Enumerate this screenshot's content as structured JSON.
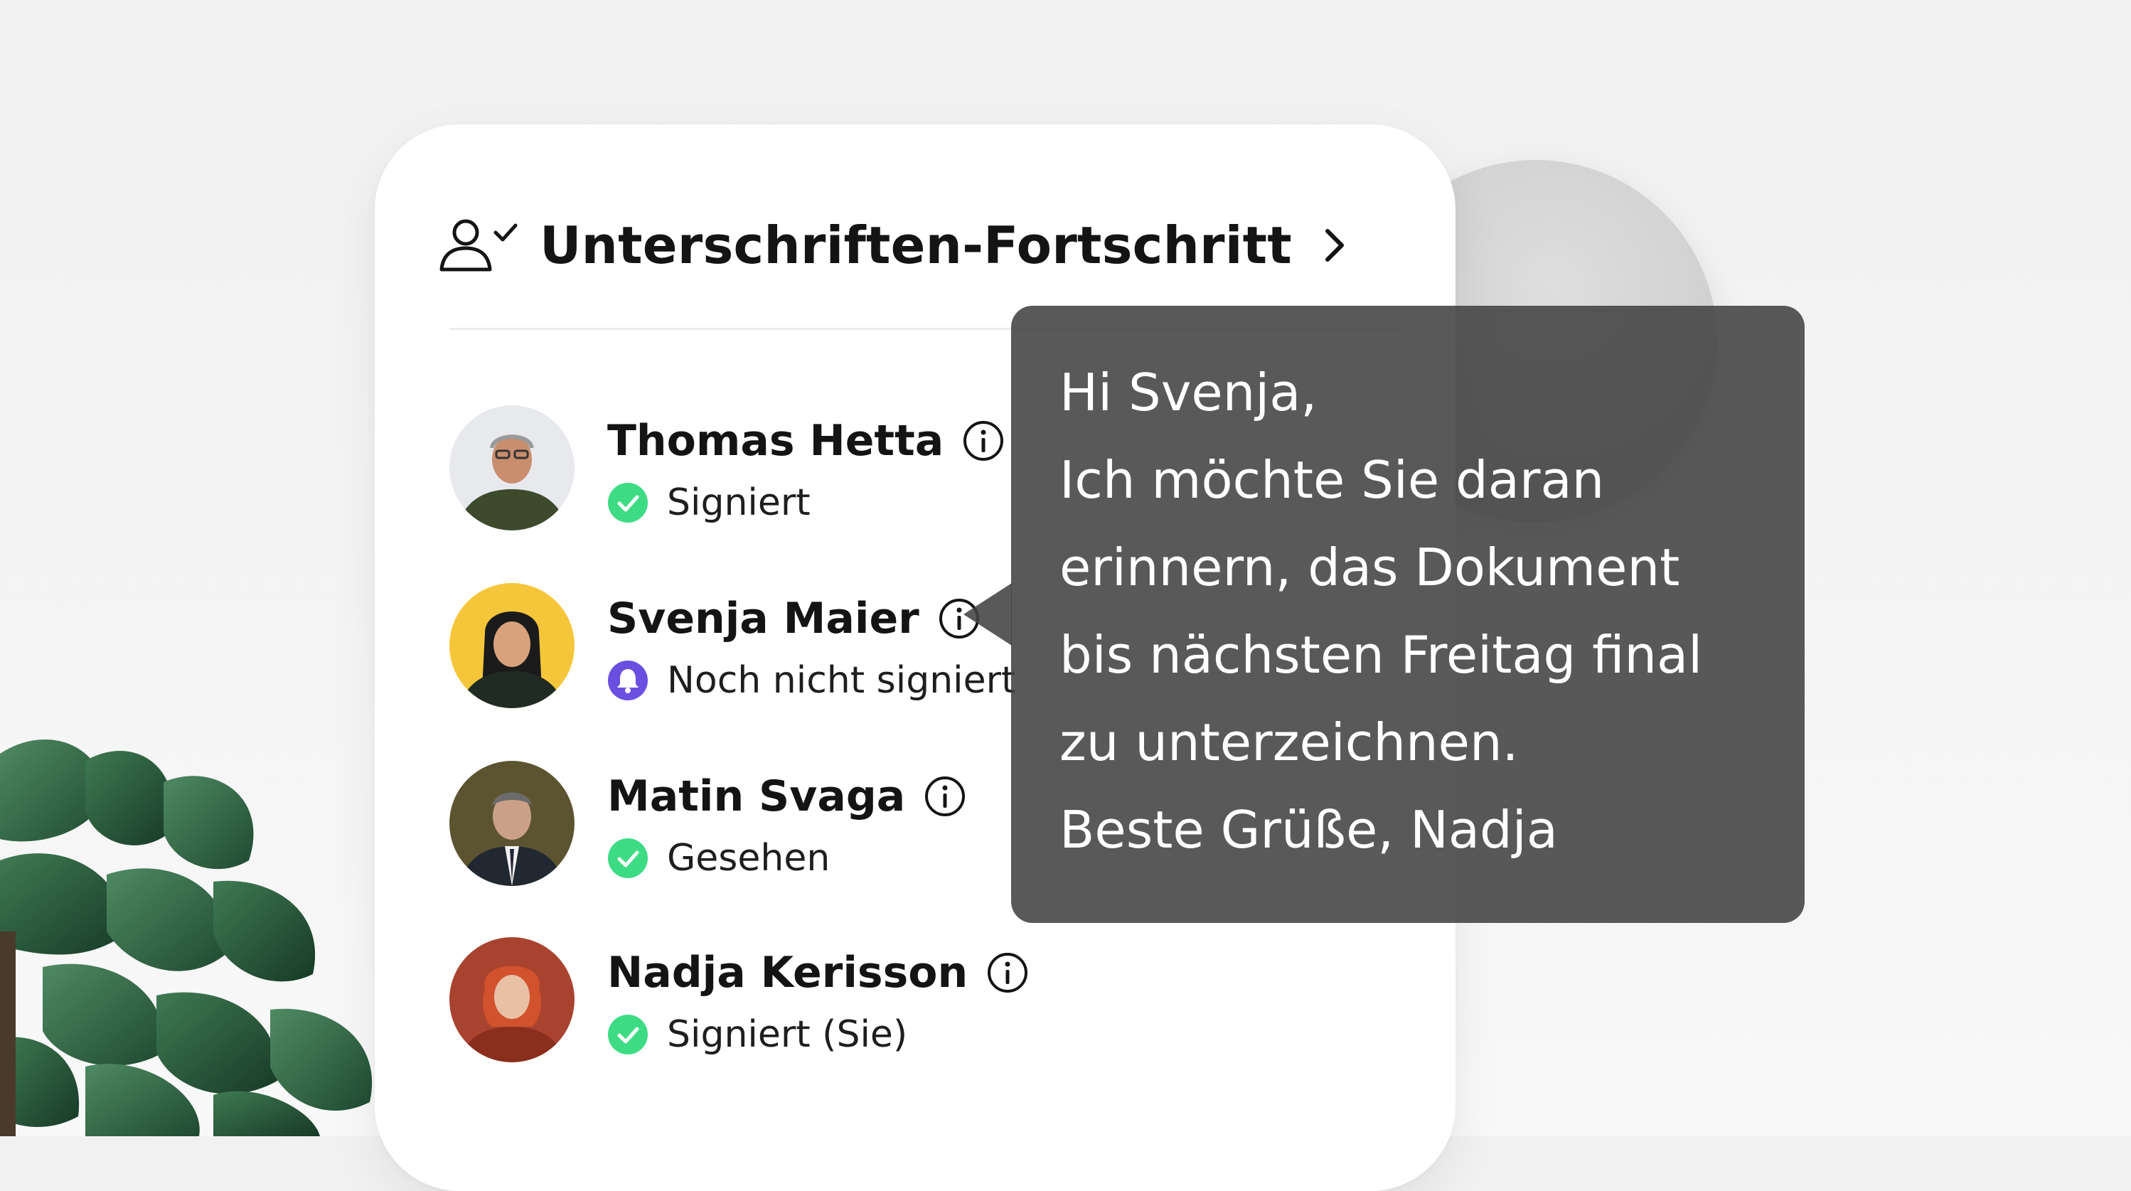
{
  "card": {
    "title": "Unterschriften-Fortschritt",
    "header_icon": "user-check-icon",
    "nav_icon": "chevron-right-icon"
  },
  "signers": [
    {
      "name": "Thomas Hetta",
      "status": "Signiert",
      "status_icon": "check-circle-icon",
      "status_color": "#3ddc84",
      "avatar_bg": "#e6e8ec"
    },
    {
      "name": "Svenja Maier",
      "status": "Noch nicht signiert",
      "status_icon": "bell-icon",
      "status_color": "#6a4fe0",
      "avatar_bg": "#f6c63a"
    },
    {
      "name": "Matin Svaga",
      "status": "Gesehen",
      "status_icon": "check-circle-icon",
      "status_color": "#3ddc84",
      "avatar_bg": "#5c5430"
    },
    {
      "name": "Nadja Kerisson",
      "status": "Signiert (Sie)",
      "status_icon": "check-circle-icon",
      "status_color": "#3ddc84",
      "avatar_bg": "#a8432f"
    }
  ],
  "tooltip": {
    "lines": [
      "Hi Svenja,",
      "Ich möchte Sie daran",
      "erinnern, das Dokument",
      "bis nächsten Freitag final",
      "zu unterzeichnen.",
      "Beste Grüße, Nadja"
    ]
  },
  "colors": {
    "card_bg": "#ffffff",
    "tooltip_bg": "#424242",
    "accent_green": "#3ddc84",
    "accent_purple": "#6a4fe0"
  }
}
